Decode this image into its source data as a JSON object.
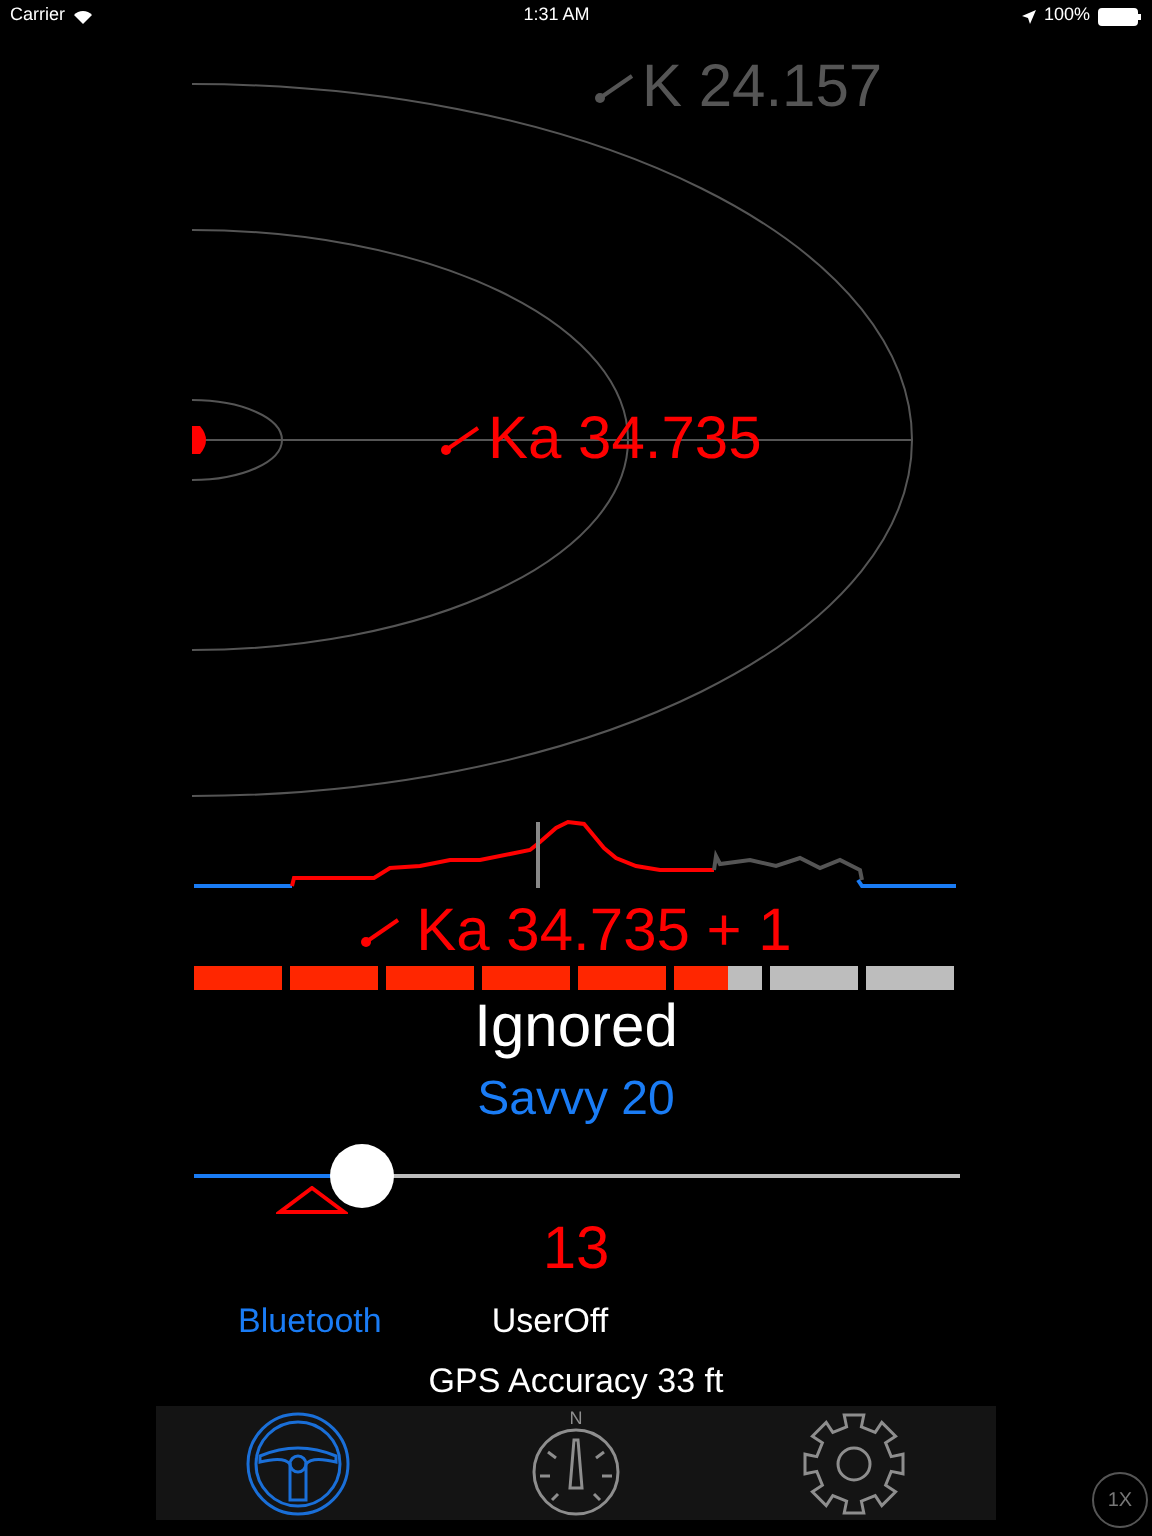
{
  "status_bar": {
    "carrier": "Carrier",
    "time": "1:31 AM",
    "battery": "100%"
  },
  "radar": {
    "alerts": [
      {
        "band": "K 24.157",
        "active": false
      },
      {
        "band": "Ka 34.735",
        "active": true
      }
    ]
  },
  "current_alert": {
    "text": "Ka 34.735 + 1",
    "strength": {
      "level": 0.7
    }
  },
  "status": "Ignored",
  "mode": "Savvy 20",
  "speed_slider": {
    "level": 0.22
  },
  "speed": "13",
  "connection": {
    "link": "Bluetooth",
    "state": "UserOff"
  },
  "gps": "GPS Accuracy 33 ft",
  "tabs": [
    {
      "kind": "drive",
      "selected": true
    },
    {
      "kind": "compass",
      "label": "N",
      "selected": false
    },
    {
      "kind": "settings",
      "selected": false
    }
  ],
  "zoom_button": "1X"
}
